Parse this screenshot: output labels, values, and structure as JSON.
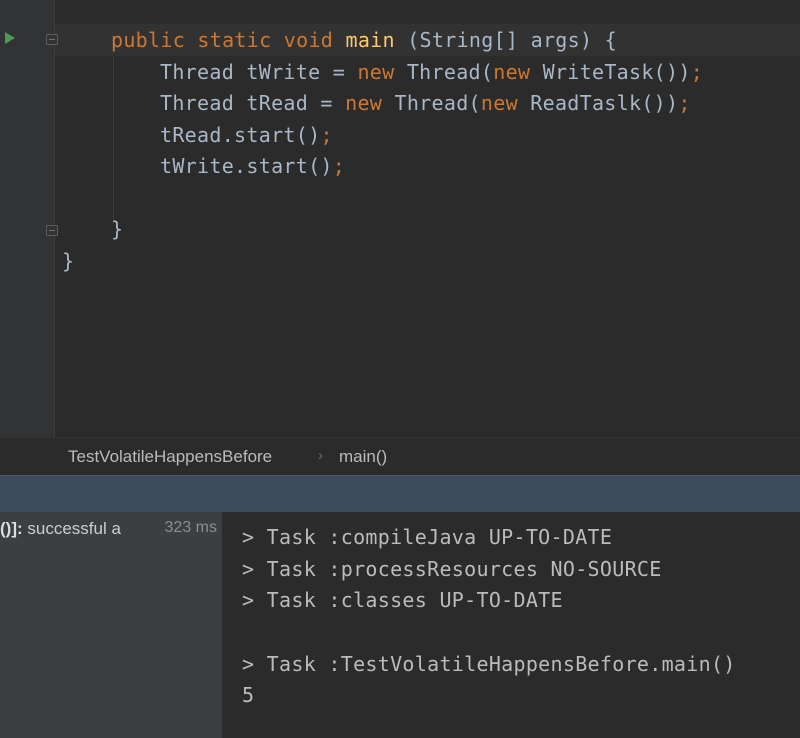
{
  "editor": {
    "lines": [
      {
        "tokens": [
          {
            "t": "public static void ",
            "c": "kw"
          },
          {
            "t": "main",
            "c": "fn"
          },
          {
            "t": " (String[] args) {",
            "c": "pl"
          }
        ]
      },
      {
        "tokens": [
          {
            "t": "Thread tWrite = ",
            "c": "pl"
          },
          {
            "t": "new ",
            "c": "kw"
          },
          {
            "t": "Thread(",
            "c": "pl"
          },
          {
            "t": "new ",
            "c": "kw"
          },
          {
            "t": "WriteTask())",
            "c": "pl"
          },
          {
            "t": ";",
            "c": "kw"
          }
        ]
      },
      {
        "tokens": [
          {
            "t": "Thread tRead = ",
            "c": "pl"
          },
          {
            "t": "new ",
            "c": "kw"
          },
          {
            "t": "Thread(",
            "c": "pl"
          },
          {
            "t": "new ",
            "c": "kw"
          },
          {
            "t": "ReadTaslk())",
            "c": "pl"
          },
          {
            "t": ";",
            "c": "kw"
          }
        ]
      },
      {
        "tokens": [
          {
            "t": "tRead.start()",
            "c": "pl"
          },
          {
            "t": ";",
            "c": "kw"
          }
        ]
      },
      {
        "tokens": [
          {
            "t": "tWrite.start()",
            "c": "pl"
          },
          {
            "t": ";",
            "c": "kw"
          }
        ]
      },
      {
        "tokens": [
          {
            "t": "}",
            "c": "pl"
          }
        ]
      },
      {
        "tokens": [
          {
            "t": "}",
            "c": "pl"
          }
        ]
      }
    ]
  },
  "breadcrumb": {
    "class_name": "TestVolatileHappensBefore",
    "separator": "›",
    "method": "main()"
  },
  "run_tree": {
    "prefix": "()]: ",
    "status": "successful a",
    "time": "323 ms"
  },
  "console": {
    "lines": [
      "> Task :compileJava UP-TO-DATE",
      "> Task :processResources NO-SOURCE",
      "> Task :classes UP-TO-DATE",
      "> Task :TestVolatileHappensBefore.main()",
      "5"
    ]
  },
  "colors": {
    "editor_bg": "#2b2b2b",
    "keyword": "#cc7832",
    "method": "#ffc66d",
    "plain": "#a9b7c6",
    "run_icon": "#499c54",
    "tool_strip": "#3d4b5c"
  }
}
